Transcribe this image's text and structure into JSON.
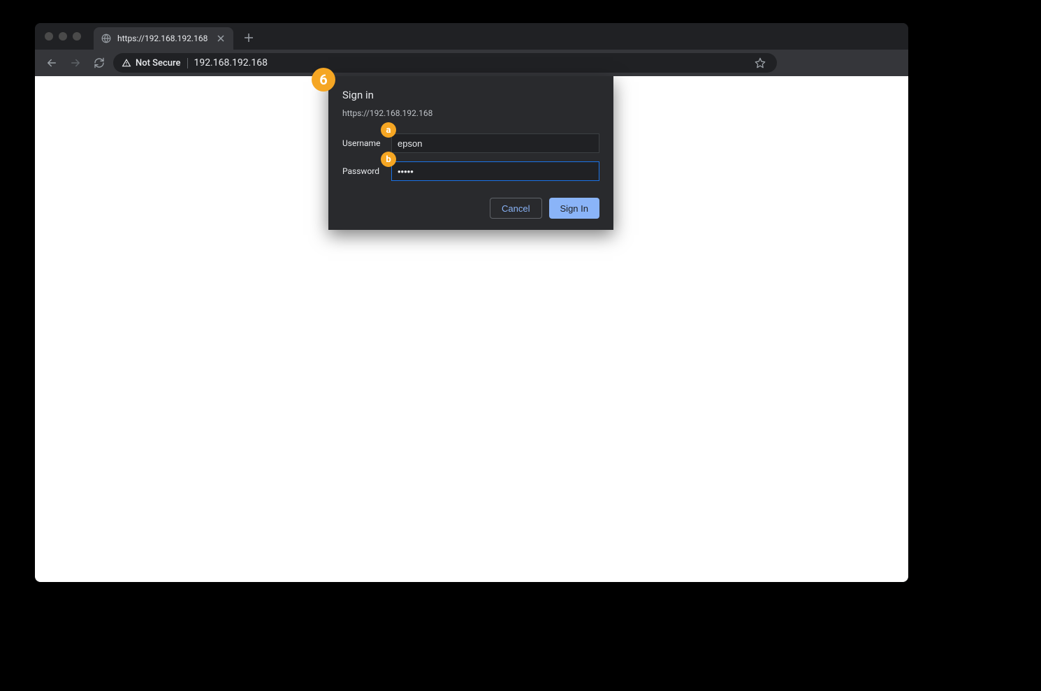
{
  "tab": {
    "title": "https://192.168.192.168",
    "favicon": "globe-icon"
  },
  "toolbar": {
    "security_label": "Not Secure",
    "url": "192.168.192.168"
  },
  "dialog": {
    "title": "Sign in",
    "origin": "https://192.168.192.168",
    "username_label": "Username",
    "username_value": "epson",
    "password_label": "Password",
    "password_value": "•••••",
    "cancel_label": "Cancel",
    "submit_label": "Sign In"
  },
  "callouts": {
    "step": "6",
    "a": "a",
    "b": "b"
  }
}
